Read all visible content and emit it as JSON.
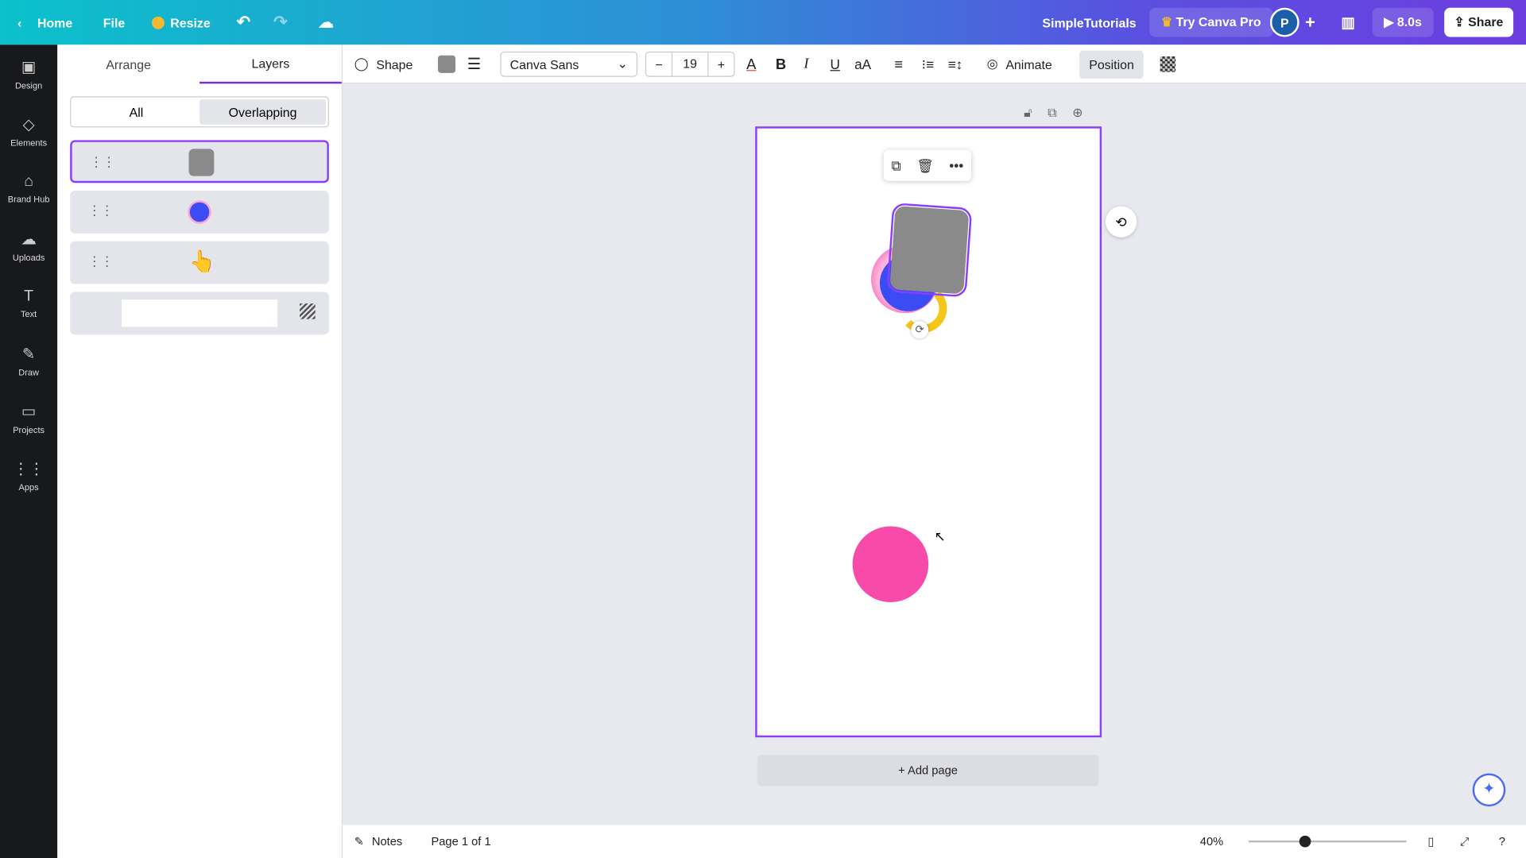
{
  "topbar": {
    "home": "Home",
    "file": "File",
    "resize": "Resize",
    "team": "SimpleTutorials",
    "try_pro": "Try Canva Pro",
    "avatar": "P",
    "timer": "8.0s",
    "share": "Share"
  },
  "rail": [
    {
      "label": "Design",
      "icon": "▣"
    },
    {
      "label": "Elements",
      "icon": "◇"
    },
    {
      "label": "Brand Hub",
      "icon": "⌂"
    },
    {
      "label": "Uploads",
      "icon": "☁"
    },
    {
      "label": "Text",
      "icon": "T"
    },
    {
      "label": "Draw",
      "icon": "✎"
    },
    {
      "label": "Projects",
      "icon": "▭"
    },
    {
      "label": "Apps",
      "icon": "⋮⋮"
    }
  ],
  "panel": {
    "tabs": [
      "Arrange",
      "Layers"
    ],
    "active_tab": "Layers",
    "filters": [
      "All",
      "Overlapping"
    ],
    "active_filter": "Overlapping"
  },
  "toolbar": {
    "shape": "Shape",
    "font": "Canva Sans",
    "font_size": "19",
    "animate": "Animate",
    "position": "Position",
    "fill_color": "#8a8a8a"
  },
  "canvas": {
    "add_page": "+ Add page",
    "shape_color": "#8a8a8a",
    "circle_color": "#f74aa9"
  },
  "bottom": {
    "notes": "Notes",
    "page": "Page 1 of 1",
    "zoom": "40%",
    "zoom_value": 40
  }
}
